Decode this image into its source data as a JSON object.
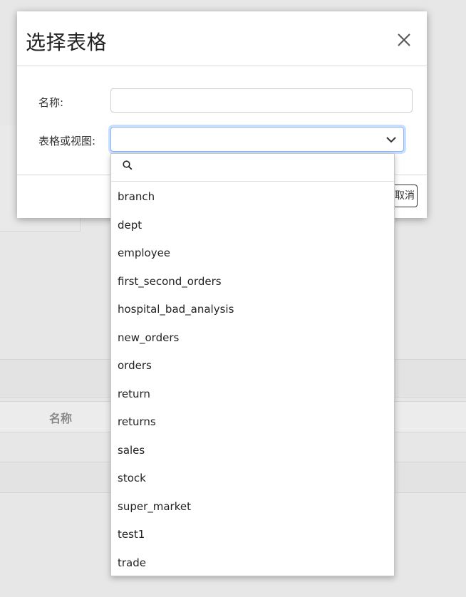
{
  "modal": {
    "title": "选择表格",
    "close_icon": "close-icon",
    "name_label": "名称:",
    "name_value": "",
    "table_label": "表格或视图:",
    "table_value": "",
    "cancel_label": "取消"
  },
  "dropdown": {
    "search_icon": "search-icon",
    "search_value": "",
    "options": [
      "branch",
      "dept",
      "employee",
      "first_second_orders",
      "hospital_bad_analysis",
      "new_orders",
      "orders",
      "return",
      "returns",
      "sales",
      "stock",
      "super_market",
      "test1",
      "trade"
    ]
  },
  "background": {
    "table_header_name": "名称"
  },
  "colors": {
    "focus_border": "#86b7fe",
    "backdrop": "#e7e7e7"
  }
}
